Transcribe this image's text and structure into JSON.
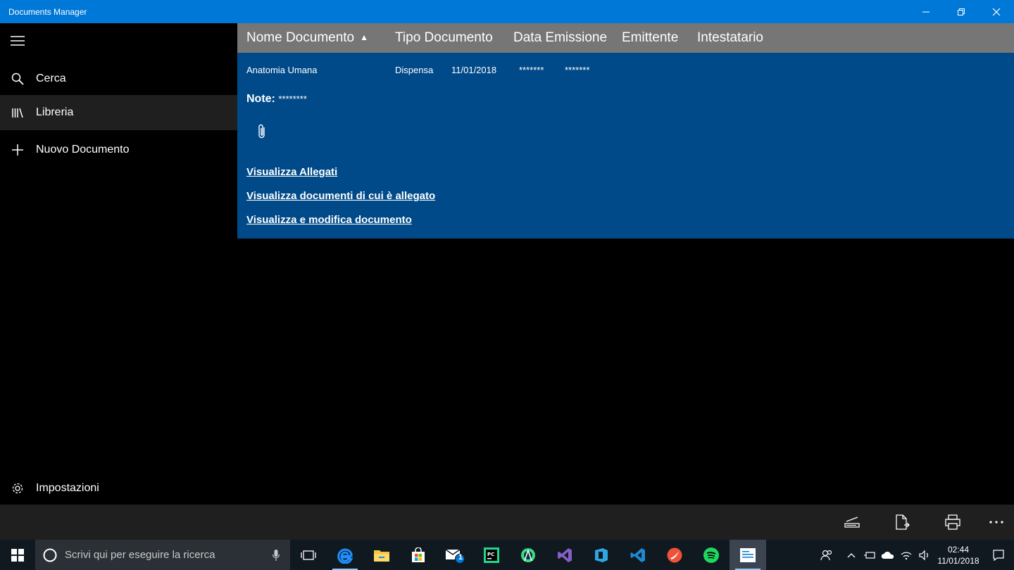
{
  "window": {
    "title": "Documents Manager"
  },
  "nav": {
    "items": [
      {
        "label": "Cerca",
        "icon": "search-icon"
      },
      {
        "label": "Libreria",
        "icon": "library-icon"
      },
      {
        "label": "Nuovo Documento",
        "icon": "add-icon"
      }
    ],
    "settings_label": "Impostazioni"
  },
  "table": {
    "columns": [
      "Nome Documento",
      "Tipo Documento",
      "Data Emissione",
      "Emittente",
      "Intestatario"
    ],
    "sort_indicator": "▲",
    "row": {
      "nome": "Anatomia Umana",
      "tipo": "Dispensa",
      "data": "11/01/2018",
      "emittente": "*******",
      "intestatario": "*******"
    }
  },
  "detail": {
    "note_label": "Note:",
    "note_value": "********",
    "links": [
      "Visualizza Allegati",
      "Visualizza documenti di cui è allegato",
      "Visualizza e modifica documento"
    ]
  },
  "taskbar": {
    "search_placeholder": "Scrivi qui per eseguire la ricerca",
    "mail_badge": "1",
    "clock_time": "02:44",
    "clock_date": "11/01/2018"
  },
  "colors": {
    "titlebar": "#0078d7",
    "detail_bg": "#004a89",
    "header_bg": "#767676"
  }
}
